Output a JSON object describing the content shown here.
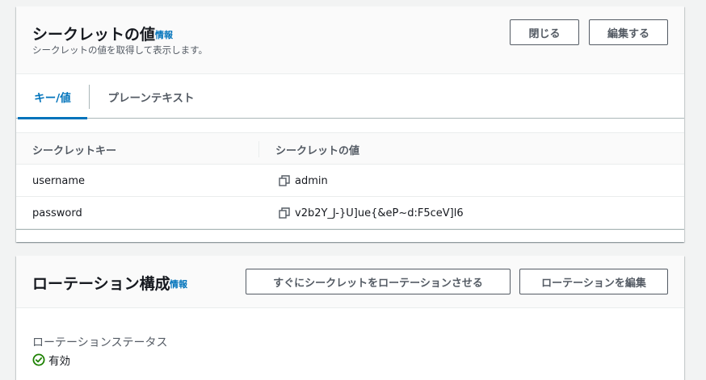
{
  "secret_panel": {
    "title": "シークレットの値",
    "info": "情報",
    "description": "シークレットの値を取得して表示します。",
    "close_button": "閉じる",
    "edit_button": "編集する",
    "tabs": [
      {
        "label": "キー/値",
        "active": true
      },
      {
        "label": "プレーンテキスト",
        "active": false
      }
    ],
    "table": {
      "columns": [
        "シークレットキー",
        "シークレットの値"
      ],
      "rows": [
        {
          "key": "username",
          "value": "admin"
        },
        {
          "key": "password",
          "value": "v2b2Y_J-}U]ue{&eP~d:F5ceV]l6"
        }
      ]
    }
  },
  "rotation_panel": {
    "title": "ローテーション構成",
    "info": "情報",
    "rotate_now_button": "すぐにシークレットをローテーションさせる",
    "edit_rotation_button": "ローテーションを編集",
    "status_label": "ローテーションステータス",
    "status_value": "有効",
    "status_icon": "check-circle-icon"
  },
  "colors": {
    "link": "#0073bb",
    "success": "#1d8102",
    "text": "#16191f",
    "muted": "#545b64"
  }
}
